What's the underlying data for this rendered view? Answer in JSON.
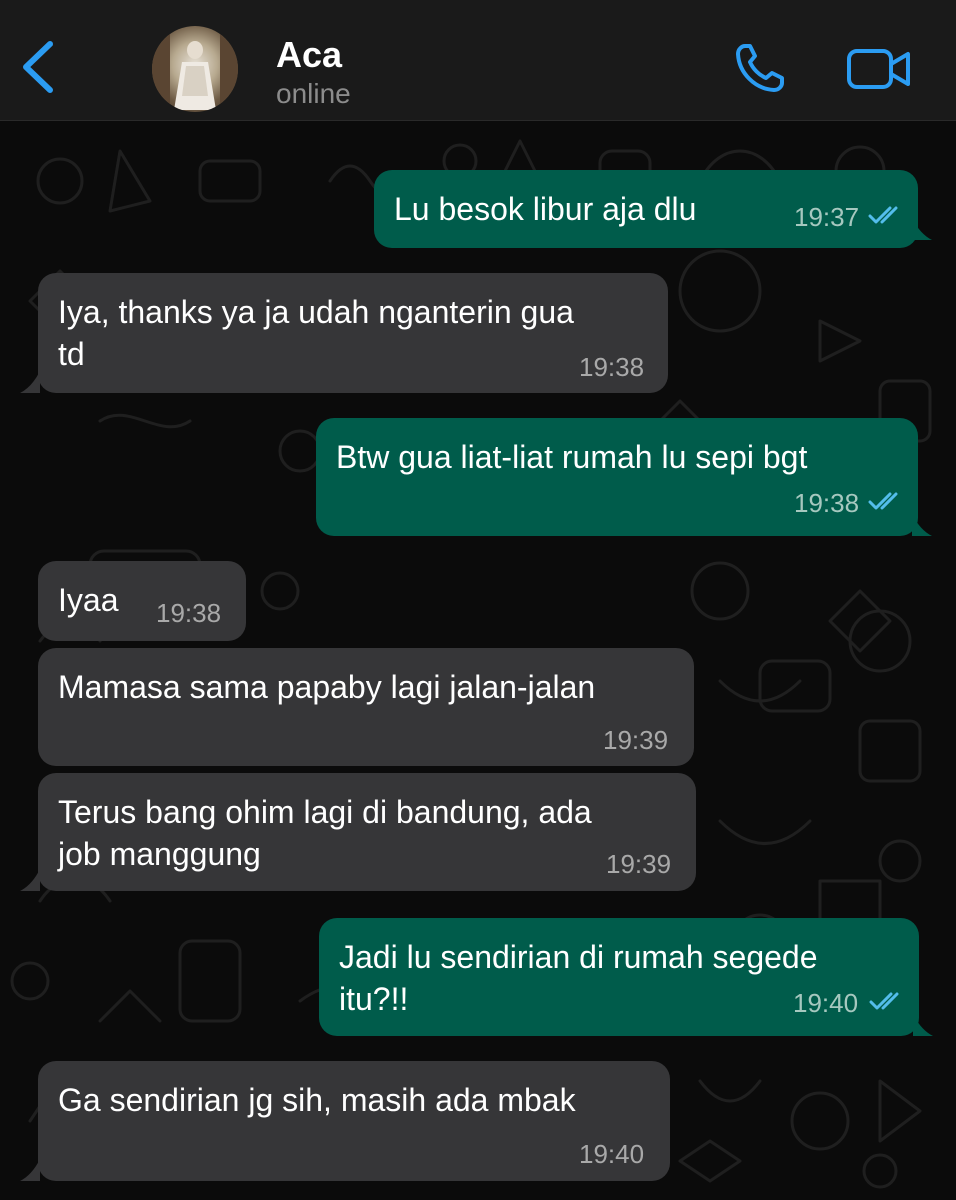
{
  "header": {
    "contact_name": "Aca",
    "status": "online"
  },
  "colors": {
    "accent": "#2b9cf2",
    "incoming_bubble": "#363638",
    "outgoing_bubble": "#005c4b",
    "background": "#0b0b0b"
  },
  "icons": {
    "back": "chevron-left-icon",
    "call": "phone-icon",
    "video": "video-camera-icon",
    "read_receipt": "double-check-icon"
  },
  "messages": [
    {
      "direction": "outgoing",
      "text": "Lu besok libur aja dlu",
      "time": "19:37",
      "status": "read"
    },
    {
      "direction": "incoming",
      "text": "Iya, thanks ya ja udah nganterin gua\ntd",
      "time": "19:38"
    },
    {
      "direction": "outgoing",
      "text": "Btw gua liat-liat rumah lu sepi bgt",
      "time": "19:38",
      "status": "read"
    },
    {
      "direction": "incoming",
      "text": "Iyaa",
      "time": "19:38"
    },
    {
      "direction": "incoming",
      "text": "Mamasa sama papaby lagi jalan-jalan",
      "time": "19:39"
    },
    {
      "direction": "incoming",
      "text": "Terus bang ohim lagi di bandung, ada\njob manggung",
      "time": "19:39"
    },
    {
      "direction": "outgoing",
      "text": "Jadi lu sendirian di rumah segede\nitu?!!",
      "time": "19:40",
      "status": "read"
    },
    {
      "direction": "incoming",
      "text": "Ga sendirian jg sih, masih ada mbak",
      "time": "19:40"
    }
  ]
}
